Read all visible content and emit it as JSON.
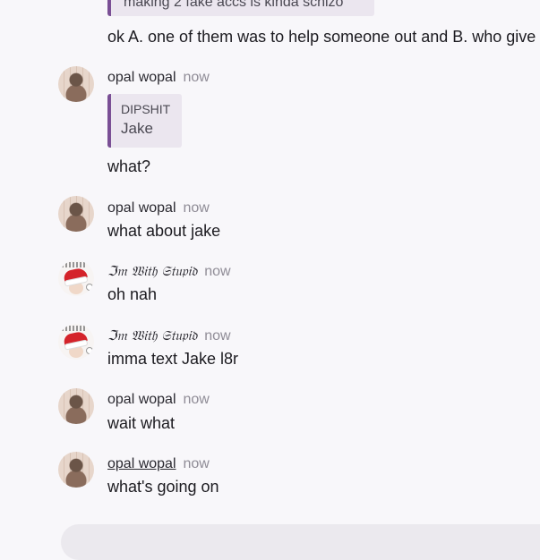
{
  "top_quote": {
    "text": "making 2 fake accs is kinda schizo"
  },
  "messages": [
    {
      "text": "ok A. one of them was to help someone out and B. who give"
    },
    {
      "author": "opal wopal",
      "time": "now",
      "reply_title": "DIPSHIT",
      "reply_body": "Jake",
      "text": "what?"
    },
    {
      "author": "opal wopal",
      "time": "now",
      "text": "what about jake"
    },
    {
      "author": "ℑ𝔪 𝔚𝔦𝔱𝔥 𝔖𝔱𝔲𝔭𝔦𝔡",
      "time": "now",
      "text": "oh nah"
    },
    {
      "author": "ℑ𝔪 𝔚𝔦𝔱𝔥 𝔖𝔱𝔲𝔭𝔦𝔡",
      "time": "now",
      "text": "imma text Jake l8r"
    },
    {
      "author": "opal wopal",
      "time": "now",
      "text": "wait what"
    },
    {
      "author": "opal wopal",
      "time": "now",
      "text": "what's going on"
    }
  ],
  "icons": {
    "avatar_opal": "avatar-photo",
    "avatar_stupid": "santa-hat-avatar"
  }
}
